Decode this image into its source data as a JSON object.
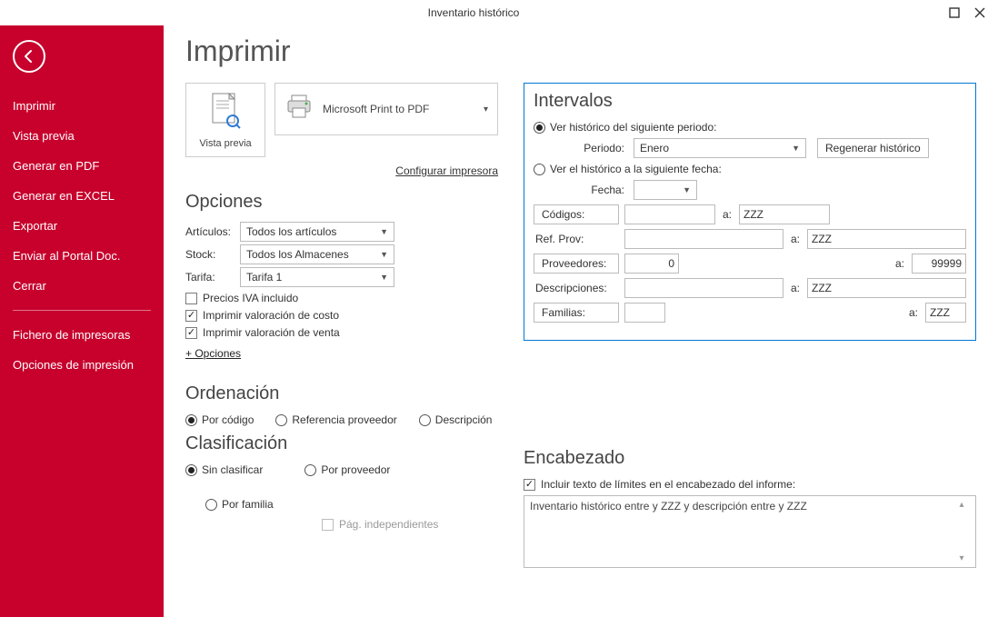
{
  "window": {
    "title": "Inventario histórico"
  },
  "sidebar": {
    "items": [
      "Imprimir",
      "Vista previa",
      "Generar en PDF",
      "Generar en EXCEL",
      "Exportar",
      "Enviar al Portal Doc.",
      "Cerrar"
    ],
    "items2": [
      "Fichero de impresoras",
      "Opciones de impresión"
    ]
  },
  "page": {
    "title": "Imprimir"
  },
  "preview": {
    "vista_previa": "Vista previa",
    "printer": "Microsoft Print to PDF",
    "config": "Configurar impresora"
  },
  "opciones": {
    "h": "Opciones",
    "articulos": {
      "lbl": "Artículos:",
      "val": "Todos los artículos"
    },
    "stock": {
      "lbl": "Stock:",
      "val": "Todos los Almacenes"
    },
    "tarifa": {
      "lbl": "Tarifa:",
      "val": "Tarifa 1"
    },
    "precios_iva": "Precios IVA incluido",
    "impr_costo": "Imprimir valoración de costo",
    "impr_venta": "Imprimir valoración de venta",
    "mas": "+ Opciones"
  },
  "ordenacion": {
    "h": "Ordenación",
    "code": "Por código",
    "ref": "Referencia proveedor",
    "desc": "Descripción"
  },
  "clasificacion": {
    "h": "Clasificación",
    "sin": "Sin clasificar",
    "prov": "Por proveedor",
    "fam": "Por familia",
    "pag": "Pág. independientes"
  },
  "intervalos": {
    "h": "Intervalos",
    "opt_periodo_label": "Ver histórico del siguiente periodo:",
    "periodo_lbl": "Periodo:",
    "periodo_val": "Enero",
    "regenerar": "Regenerar histórico",
    "opt_fecha_label": "Ver el histórico a la siguiente fecha:",
    "fecha_lbl": "Fecha:",
    "fecha_val": "",
    "codigos_btn": "Códigos:",
    "codigos_a": "",
    "codigos_b": "ZZZ",
    "refprov_lbl": "Ref. Prov:",
    "refprov_a": "",
    "refprov_b": "ZZZ",
    "prove_btn": "Proveedores:",
    "prove_a": "0",
    "prove_b": "99999",
    "desc_lbl": "Descripciones:",
    "desc_a": "",
    "desc_b": "ZZZ",
    "familias_btn": "Familias:",
    "familias_a": "",
    "familias_b": "ZZZ",
    "a": "a:"
  },
  "encabezado": {
    "h": "Encabezado",
    "chk": "Incluir texto de límites en el encabezado del informe:",
    "text": "Inventario histórico entre  y ZZZ y descripción entre  y ZZZ"
  }
}
